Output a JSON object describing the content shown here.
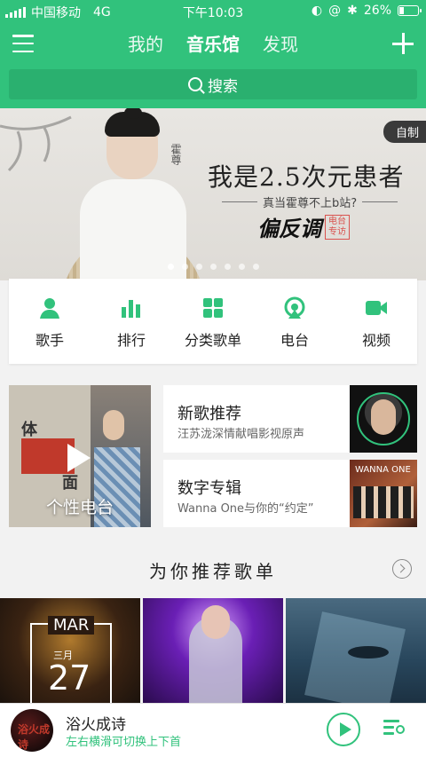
{
  "status_bar": {
    "carrier": "中国移动",
    "network": "4G",
    "time": "下午10:03",
    "battery": "26%",
    "battery_level": 0.26
  },
  "nav": {
    "tabs": [
      {
        "label": "我的",
        "active": false
      },
      {
        "label": "音乐馆",
        "active": true
      },
      {
        "label": "发现",
        "active": false
      }
    ]
  },
  "search": {
    "placeholder": "搜索"
  },
  "banner": {
    "badge": "自制",
    "title": "我是2.5次元患者",
    "subtitle": "真当霍尊不上b站?",
    "brand": "偏反调",
    "brand_tag": "电台专访",
    "signature": "霍尊",
    "dots_count": 7,
    "active_dot": 0
  },
  "categories": [
    {
      "label": "歌手",
      "icon": "singer-icon"
    },
    {
      "label": "排行",
      "icon": "chart-icon"
    },
    {
      "label": "分类歌单",
      "icon": "grid-icon"
    },
    {
      "label": "电台",
      "icon": "radio-icon"
    },
    {
      "label": "视频",
      "icon": "video-icon"
    }
  ],
  "personal_radio": {
    "label": "个性电台",
    "poster_text_1": "体",
    "poster_text_2": "面"
  },
  "features": [
    {
      "title": "新歌推荐",
      "subtitle": "汪苏泷深情献唱影视原声"
    },
    {
      "title": "数字专辑",
      "subtitle": "Wanna One与你的“约定”",
      "cover_text": "WANNA ONE"
    }
  ],
  "recommend": {
    "title": "为你推荐歌单",
    "playlists": [
      {
        "month": "MAR",
        "cn_month": "三月",
        "day": "27"
      },
      {},
      {}
    ]
  },
  "player": {
    "song": "浴火成诗",
    "hint": "左右横滑可切换上下首",
    "avatar_text": "浴火成诗"
  },
  "colors": {
    "accent": "#31c27c"
  }
}
